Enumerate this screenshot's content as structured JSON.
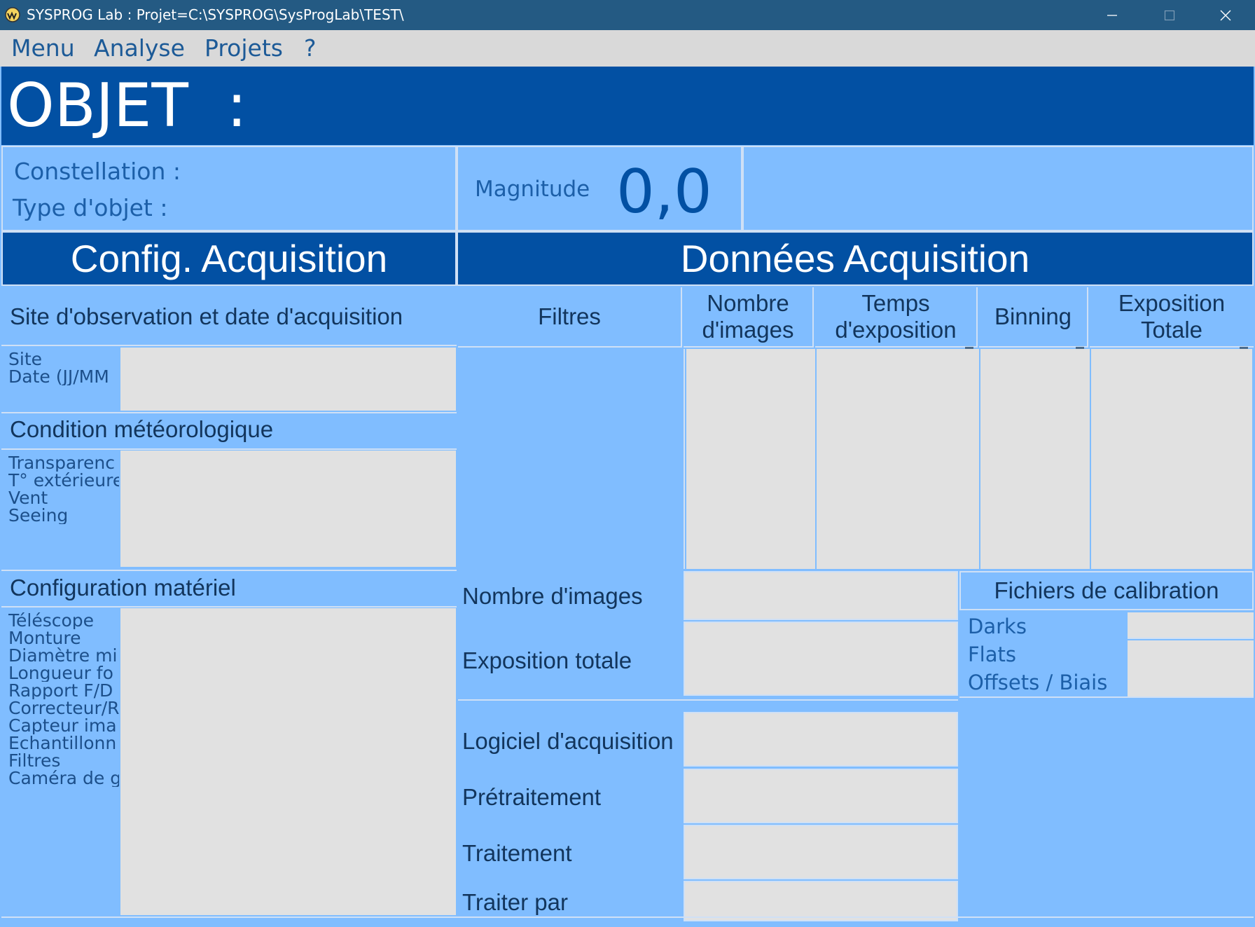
{
  "window": {
    "title": "SYSPROG Lab : Projet=C:\\SYSPROG\\SysProgLab\\TEST\\",
    "icon": "sysprog-app-icon",
    "controls": [
      "minimize-icon",
      "maximize-icon",
      "close-icon"
    ]
  },
  "menu": {
    "items": [
      "Menu",
      "Analyse",
      "Projets",
      "?"
    ]
  },
  "objet": {
    "title": "OBJET  :"
  },
  "info": {
    "constellation_label": "Constellation :",
    "type_label": "Type d'objet :",
    "magnitude_label": "Magnitude",
    "magnitude_value": "0,0"
  },
  "config": {
    "header": "Config. Acquisition",
    "site_section": "Site d'observation et date d'acquisition",
    "site_fields": [
      "Site",
      "Date (JJ/MM"
    ],
    "meteo_section": "Condition météorologique",
    "meteo_fields": [
      "Transparenc",
      "T° extérieure",
      "Vent",
      "Seeing"
    ],
    "materiel_section": "Configuration matériel",
    "materiel_fields": [
      "Téléscope",
      "Monture",
      "Diamètre mi",
      "Longueur fo",
      "Rapport F/D",
      "Correcteur/R",
      "Capteur ima",
      "Echantillonn",
      "Filtres",
      "Caméra de g"
    ]
  },
  "donnees": {
    "header": "Données Acquisition",
    "columns": [
      "Filtres",
      "Nombre\nd'images",
      "Temps\nd'exposition",
      "Binning",
      "Exposition\nTotale"
    ],
    "nombre_images_label": "Nombre d'images",
    "exposition_totale_label": "Exposition totale",
    "logiciel_label": "Logiciel d'acquisition",
    "pretraitement_label": "Prétraitement",
    "traitement_label": "Traitement",
    "traiter_par_label": "Traiter par"
  },
  "calibration": {
    "header": "Fichiers de calibration",
    "items": [
      "Darks",
      "Flats",
      "Offsets / Biais"
    ]
  },
  "colors": {
    "titlebar": "#245a83",
    "menubar": "#d9d9d9",
    "header_blue": "#0250a3",
    "panel_blue": "#80bdff",
    "field_grey": "#e1e1e1",
    "menu_text": "#1c5a97"
  }
}
